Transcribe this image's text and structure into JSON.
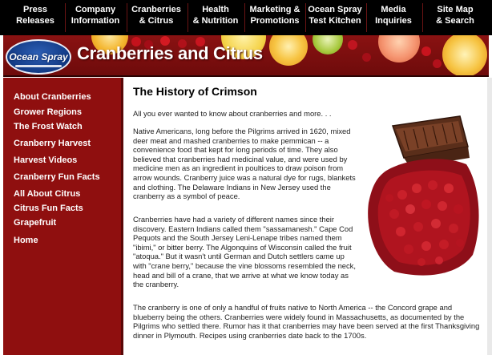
{
  "nav": {
    "items": [
      {
        "line1": "Press",
        "line2": "Releases"
      },
      {
        "line1": "Company",
        "line2": "Information"
      },
      {
        "line1": "Cranberries",
        "line2": "& Citrus"
      },
      {
        "line1": "Health",
        "line2": "& Nutrition"
      },
      {
        "line1": "Marketing &",
        "line2": "Promotions"
      },
      {
        "line1": "Ocean Spray",
        "line2": "Test Kitchen"
      },
      {
        "line1": "Media",
        "line2": "Inquiries"
      },
      {
        "line1": "Site Map",
        "line2": "& Search"
      }
    ]
  },
  "banner": {
    "logo_text": "Ocean Spray",
    "title": "Cranberries and Citrus"
  },
  "sidebar": {
    "links": [
      "About Cranberries",
      "Grower Regions",
      "The Frost Watch",
      "Cranberry Harvest",
      "Harvest Videos",
      "Cranberry Fun Facts",
      "All About Citrus",
      "Citrus Fun Facts",
      "Grapefruit",
      "Home"
    ]
  },
  "content": {
    "heading": "The History of Crimson",
    "intro": "All you ever wanted to know about cranberries and more. . .",
    "para1": "Native Americans, long before the Pilgrims arrived in 1620, mixed deer meat and mashed cranberries to make pemmican -- a convenience food that kept for long periods of time. They also believed that cranberries had medicinal value, and were used by medicine men as an ingredient in poultices to draw poison from arrow wounds. Cranberry juice was a natural dye for rugs, blankets and clothing. The Delaware Indians in New Jersey used the cranberry as a symbol of peace.",
    "para2": "Cranberries have had a variety of different names since their discovery. Eastern Indians called them \"sassamanesh.\" Cape Cod Pequots and the South Jersey Leni-Lenape tribes named them \"ibimi,\" or bitter berry. The Algonquins of Wisconsin called the fruit \"atoqua.\" But it wasn't until German and Dutch settlers came up with \"crane berry,\" because the vine blossoms resembled the neck, head and bill of a crane, that we arrive at what we know today as the cranberry.",
    "para3": "The cranberry is one of only a handful of fruits native to North America -- the Concord grape and blueberry being the others. Cranberries were widely found in Massachusetts, as documented by the Pilgrims who settled there. Rumor has it that cranberries may have been served at the first Thanksgiving dinner in Plymouth. Recipes using cranberries date back to the 1700s."
  },
  "colors": {
    "nav_bg": "#000000",
    "sidebar_bg": "#8f0f0f",
    "banner_bg": "#8a1212",
    "logo_bg": "#123a84"
  }
}
